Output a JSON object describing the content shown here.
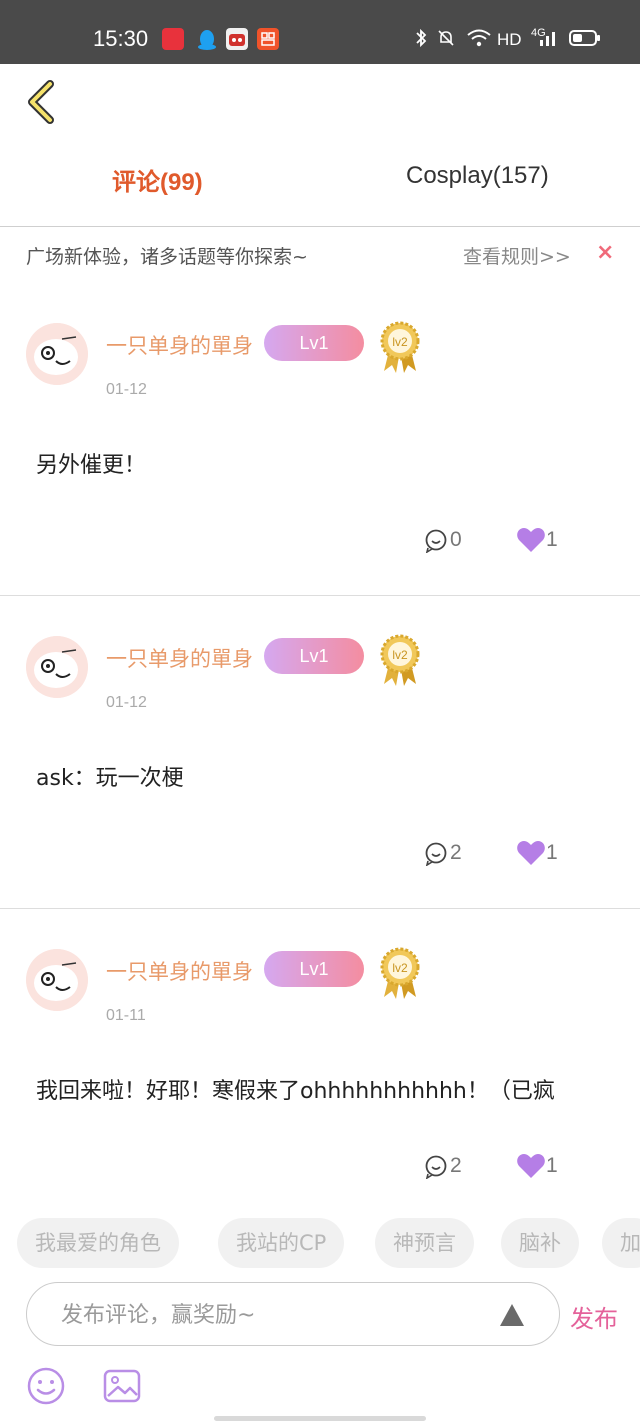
{
  "status_bar": {
    "time": "15:30",
    "network": "HD",
    "signal_type": "4G",
    "app_icons": [
      "news-app-icon",
      "qq-icon",
      "game-app-icon",
      "store-app-icon"
    ]
  },
  "header": {
    "tabs": [
      {
        "label": "评论(99)",
        "active": true
      },
      {
        "label": "Cosplay(157)",
        "active": false
      }
    ]
  },
  "notice": {
    "text": "广场新体验，诸多话题等你探索~",
    "rules_link": "查看规则>>",
    "close": "×"
  },
  "comments": [
    {
      "username": "一只单身的單身",
      "level": "Lv1",
      "medal": "lv2",
      "date": "01-12",
      "content": "另外催更！",
      "reply_count": "0",
      "like_count": "1"
    },
    {
      "username": "一只单身的單身",
      "level": "Lv1",
      "medal": "lv2",
      "date": "01-12",
      "content": "ask：玩一次梗",
      "reply_count": "2",
      "like_count": "1"
    },
    {
      "username": "一只单身的單身",
      "level": "Lv1",
      "medal": "lv2",
      "date": "01-11",
      "content": "我回来啦！好耶！寒假来了ohhhhhhhhhhh！（已疯",
      "reply_count": "2",
      "like_count": "1"
    }
  ],
  "bottom": {
    "topics": [
      "我最爱的角色",
      "我站的CP",
      "神预言",
      "脑补",
      "加"
    ],
    "input_placeholder": "发布评论，赢奖励~",
    "publish_label": "发布"
  },
  "colors": {
    "active_tab": "#e05a2c",
    "username": "#e89a6a",
    "like": "#b57ee6",
    "publish": "#e4629a",
    "close": "#f06a7a"
  }
}
